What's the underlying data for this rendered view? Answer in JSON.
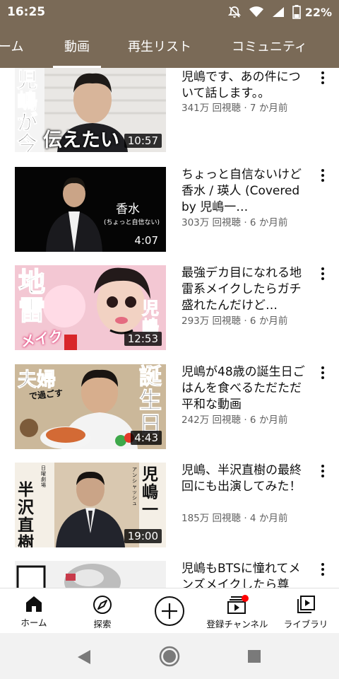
{
  "status_bar": {
    "time": "16:25",
    "battery": "22%"
  },
  "tabs": [
    {
      "label": "ーム"
    },
    {
      "label": "動画"
    },
    {
      "label": "再生リスト"
    },
    {
      "label": "コミュニティ"
    }
  ],
  "videos": [
    {
      "title": "児嶋です、あの件について話します。。",
      "meta": "341万 回視聴 · 7 か月前",
      "duration": "10:57",
      "thumb_text": [
        "児",
        "嶋",
        "が",
        "今",
        "伝えたい"
      ]
    },
    {
      "title": "ちょっと自信ないけど香水 / 瑛人 (Covered by 児嶋一…",
      "meta": "303万 回視聴 · 6 か月前",
      "duration": "4:07",
      "thumb_text": [
        "香水",
        "(ちょっと自信ない)"
      ]
    },
    {
      "title": "最強デカ目になれる地雷系メイクしたらガチ盛れたんだけど…",
      "meta": "293万 回視聴 · 6 か月前",
      "duration": "12:53",
      "thumb_text": [
        "地",
        "雷",
        "メイク",
        "児",
        "嶋"
      ]
    },
    {
      "title": "児嶋が48歳の誕生日ごはんを食べるただただ平和な動画",
      "meta": "242万 回視聴 · 6 か月前",
      "duration": "4:43",
      "thumb_text": [
        "夫婦",
        "で過ごす",
        "誕",
        "生",
        "日"
      ]
    },
    {
      "title": "児嶋、半沢直樹の最終回にも出演してみた！",
      "meta": "185万 回視聴 · 4 か月前",
      "duration": "19:00",
      "thumb_text": [
        "半",
        "沢",
        "直",
        "樹",
        "日曜劇場",
        "児",
        "嶋",
        "一",
        "アンシャッシュ"
      ]
    },
    {
      "title": "児嶋もBTSに憧れてメンズメイクしたら尊",
      "meta": "",
      "duration": "",
      "thumb_text": []
    }
  ],
  "bottom_nav": [
    {
      "label": "ホーム",
      "icon": "home-icon"
    },
    {
      "label": "探索",
      "icon": "compass-icon"
    },
    {
      "label": "",
      "icon": "create-plus-icon"
    },
    {
      "label": "登録チャンネル",
      "icon": "subscriptions-icon"
    },
    {
      "label": "ライブラリ",
      "icon": "library-icon"
    }
  ],
  "colors": {
    "header_bg": "#7a6a57",
    "notification_dot": "#ff0000",
    "text_primary": "#0f0f0f",
    "text_secondary": "#606060"
  }
}
